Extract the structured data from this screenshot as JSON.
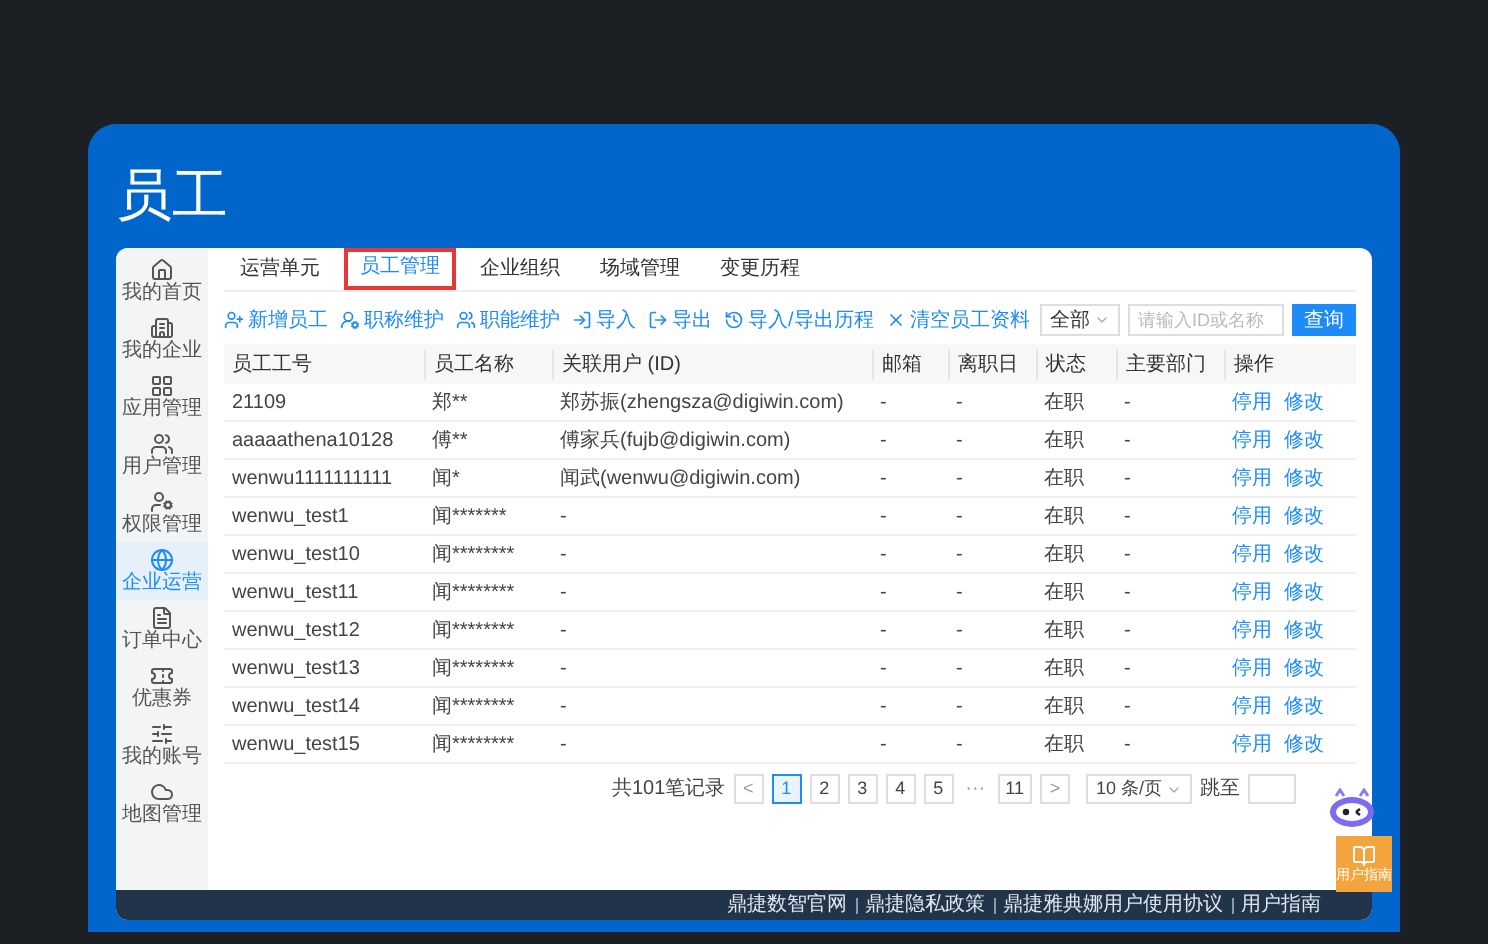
{
  "page_title": "员工",
  "sidebar": {
    "items": [
      {
        "label": "我的首页",
        "selected": false
      },
      {
        "label": "我的企业",
        "selected": false
      },
      {
        "label": "应用管理",
        "selected": false
      },
      {
        "label": "用户管理",
        "selected": false
      },
      {
        "label": "权限管理",
        "selected": false
      },
      {
        "label": "企业运营",
        "selected": true
      },
      {
        "label": "订单中心",
        "selected": false
      },
      {
        "label": "优惠券",
        "selected": false
      },
      {
        "label": "我的账号",
        "selected": false
      },
      {
        "label": "地图管理",
        "selected": false
      }
    ]
  },
  "tabs": [
    {
      "label": "运营单元",
      "selected": false,
      "highlighted": false
    },
    {
      "label": "员工管理",
      "selected": true,
      "highlighted": true
    },
    {
      "label": "企业组织",
      "selected": false,
      "highlighted": false
    },
    {
      "label": "场域管理",
      "selected": false,
      "highlighted": false
    },
    {
      "label": "变更历程",
      "selected": false,
      "highlighted": false
    }
  ],
  "toolbar": [
    "新增员工",
    "职称维护",
    "职能维护",
    "导入",
    "导出",
    "导入/导出历程",
    "清空员工资料"
  ],
  "filter": {
    "value": "全部"
  },
  "search": {
    "placeholder": "请输入ID或名称"
  },
  "query_button": "查询",
  "table": {
    "columns": [
      "员工工号",
      "员工名称",
      "关联用户 (ID)",
      "邮箱",
      "离职日",
      "状态",
      "主要部门",
      "操作"
    ],
    "rows": [
      {
        "cells": [
          "21109",
          "郑**",
          "郑苏振(zhengsza@digiwin.com)",
          "-",
          "-",
          "在职",
          "-"
        ],
        "actions": [
          "停用",
          "修改"
        ]
      },
      {
        "cells": [
          "aaaaathena10128",
          "傅**",
          "傅家兵(fujb@digiwin.com)",
          "-",
          "-",
          "在职",
          "-"
        ],
        "actions": [
          "停用",
          "修改"
        ]
      },
      {
        "cells": [
          "wenwu1111111111",
          "闻*",
          "闻武(wenwu@digiwin.com)",
          "-",
          "-",
          "在职",
          "-"
        ],
        "actions": [
          "停用",
          "修改"
        ]
      },
      {
        "cells": [
          "wenwu_test1",
          "闻*******",
          "-",
          "-",
          "-",
          "在职",
          "-"
        ],
        "actions": [
          "停用",
          "修改"
        ]
      },
      {
        "cells": [
          "wenwu_test10",
          "闻********",
          "-",
          "-",
          "-",
          "在职",
          "-"
        ],
        "actions": [
          "停用",
          "修改"
        ]
      },
      {
        "cells": [
          "wenwu_test11",
          "闻********",
          "-",
          "-",
          "-",
          "在职",
          "-"
        ],
        "actions": [
          "停用",
          "修改"
        ]
      },
      {
        "cells": [
          "wenwu_test12",
          "闻********",
          "-",
          "-",
          "-",
          "在职",
          "-"
        ],
        "actions": [
          "停用",
          "修改"
        ]
      },
      {
        "cells": [
          "wenwu_test13",
          "闻********",
          "-",
          "-",
          "-",
          "在职",
          "-"
        ],
        "actions": [
          "停用",
          "修改"
        ]
      },
      {
        "cells": [
          "wenwu_test14",
          "闻********",
          "-",
          "-",
          "-",
          "在职",
          "-"
        ],
        "actions": [
          "停用",
          "修改"
        ]
      },
      {
        "cells": [
          "wenwu_test15",
          "闻********",
          "-",
          "-",
          "-",
          "在职",
          "-"
        ],
        "actions": [
          "停用",
          "修改"
        ]
      }
    ]
  },
  "pagination": {
    "total": "共101笔记录",
    "items": [
      {
        "kind": "prev",
        "label": "<"
      },
      {
        "kind": "page",
        "label": "1",
        "selected": true
      },
      {
        "kind": "page",
        "label": "2",
        "selected": false
      },
      {
        "kind": "page",
        "label": "3",
        "selected": false
      },
      {
        "kind": "page",
        "label": "4",
        "selected": false
      },
      {
        "kind": "page",
        "label": "5",
        "selected": false
      },
      {
        "kind": "ellipsis",
        "label": "···"
      },
      {
        "kind": "page",
        "label": "11",
        "selected": false
      },
      {
        "kind": "next",
        "label": ">"
      }
    ],
    "page_size": "10 条/页",
    "jump_label": "跳至"
  },
  "footer": [
    "鼎捷数智官网",
    "鼎捷隐私政策",
    "鼎捷雅典娜用户使用协议",
    "用户指南"
  ],
  "guide_button": "用户指南"
}
